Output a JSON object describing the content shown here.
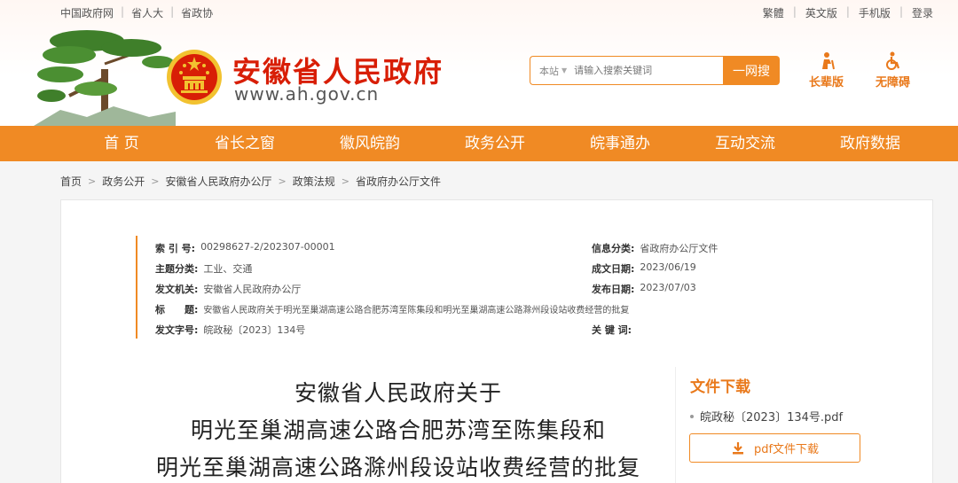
{
  "topbar": {
    "left_links": [
      "中国政府网",
      "省人大",
      "省政协"
    ],
    "right_links": [
      "繁體",
      "英文版",
      "手机版",
      "登录"
    ]
  },
  "site": {
    "title": "安徽省人民政府",
    "url": "www.ah.gov.cn"
  },
  "search": {
    "scope": "本站",
    "placeholder": "请输入搜索关键词",
    "button": "一网搜"
  },
  "tools": {
    "elder": "长辈版",
    "accessible": "无障碍"
  },
  "nav": [
    "首 页",
    "省长之窗",
    "徽风皖韵",
    "政务公开",
    "皖事通办",
    "互动交流",
    "政府数据"
  ],
  "breadcrumb": [
    "首页",
    "政务公开",
    "安徽省人民政府办公厅",
    "政策法规",
    "省政府办公厅文件"
  ],
  "meta": {
    "index_no": {
      "key": "索 引 号:",
      "value": "00298627-2/202307-00001"
    },
    "topic": {
      "key": "主题分类:",
      "value": "工业、交通"
    },
    "issuer": {
      "key": "发文机关:",
      "value": "安徽省人民政府办公厅"
    },
    "title": {
      "key": "标　　题:",
      "value": "安徽省人民政府关于明光至巢湖高速公路合肥苏湾至陈集段和明光至巢湖高速公路滁州段设站收费经营的批复"
    },
    "doc_no": {
      "key": "发文字号:",
      "value": "皖政秘〔2023〕134号"
    },
    "info_class": {
      "key": "信息分类:",
      "value": "省政府办公厅文件"
    },
    "written_date": {
      "key": "成文日期:",
      "value": "2023/06/19"
    },
    "publish_date": {
      "key": "发布日期:",
      "value": "2023/07/03"
    },
    "keywords": {
      "key": "关 键 词:",
      "value": ""
    }
  },
  "document": {
    "title_lines": [
      "安徽省人民政府关于",
      "明光至巢湖高速公路合肥苏湾至陈集段和",
      "明光至巢湖高速公路滁州段设站收费经营的批复"
    ]
  },
  "download": {
    "heading": "文件下载",
    "file_name": "皖政秘〔2023〕134号.pdf",
    "button": "pdf文件下载"
  },
  "colors": {
    "brand_orange": "#f08a24",
    "title_red": "#d81e06"
  }
}
